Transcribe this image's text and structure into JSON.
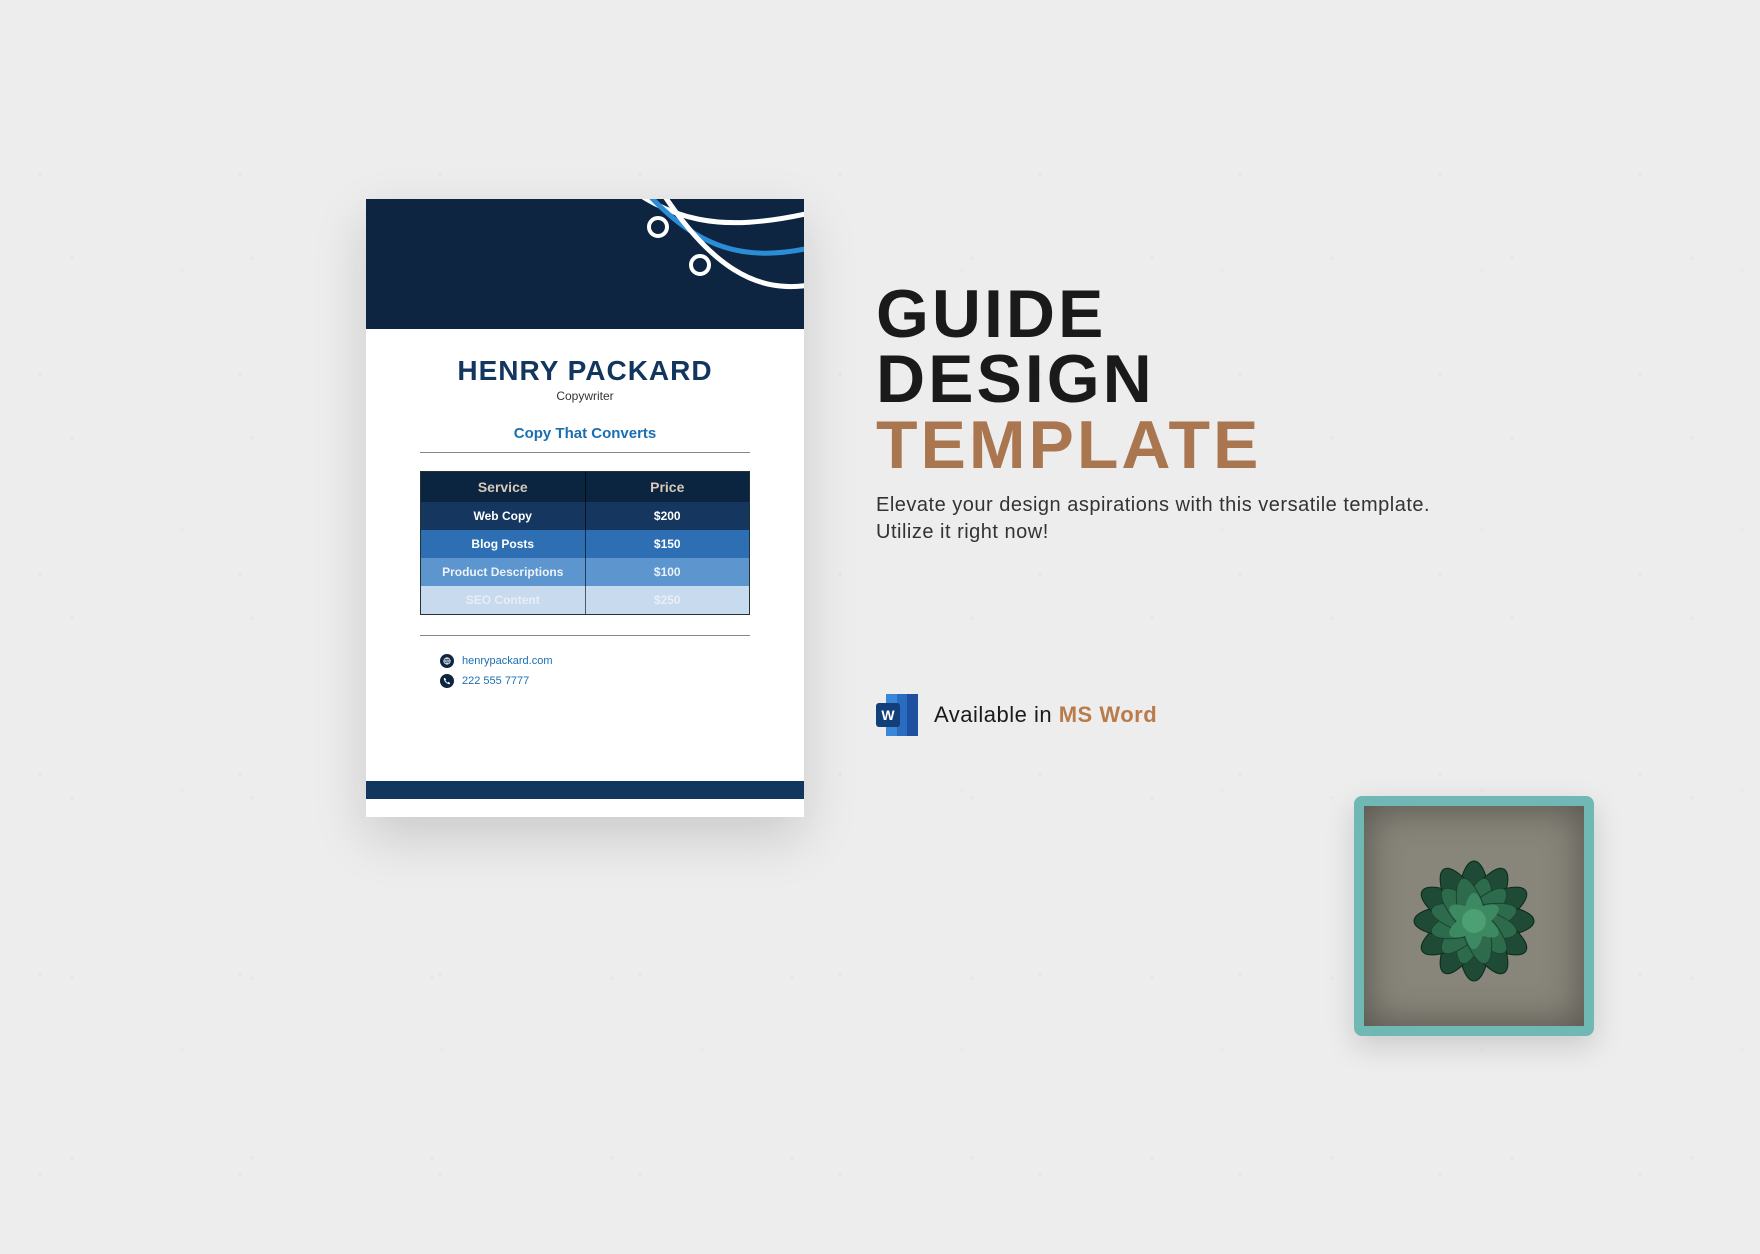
{
  "document": {
    "name": "HENRY PACKARD",
    "role": "Copywriter",
    "tagline": "Copy That Converts",
    "table": {
      "header": {
        "col1": "Service",
        "col2": "Price"
      },
      "rows": [
        {
          "service": "Web Copy",
          "price": "$200"
        },
        {
          "service": "Blog Posts",
          "price": "$150"
        },
        {
          "service": "Product Descriptions",
          "price": "$100"
        },
        {
          "service": "SEO Content",
          "price": "$250"
        }
      ]
    },
    "contacts": {
      "website": "henrypackard.com",
      "phone": "222 555 7777"
    }
  },
  "promo": {
    "line1": "GUIDE",
    "line2": "DESIGN",
    "line3": "TEMPLATE",
    "description": "Elevate your design aspirations with this versatile template. Utilize it right now!"
  },
  "availability": {
    "prefix": "Available in ",
    "product": "MS Word",
    "badge_letter": "W"
  }
}
